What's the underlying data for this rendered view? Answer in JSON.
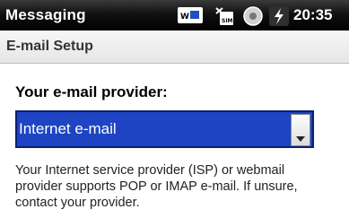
{
  "statusbar": {
    "app_title": "Messaging",
    "time": "20:35",
    "icons": [
      "network-icon",
      "sim-icon",
      "connectivity-icon",
      "battery-charging-icon"
    ]
  },
  "titlebar": {
    "title": "E-mail Setup"
  },
  "form": {
    "provider_label": "Your e-mail provider:",
    "provider_value": "Internet e-mail",
    "help_text": "Your Internet service provider (ISP) or webmail provider supports POP or IMAP e-mail.  If unsure, contact your provider."
  },
  "colors": {
    "selection": "#1e44c4",
    "statusbar": "#000000"
  }
}
